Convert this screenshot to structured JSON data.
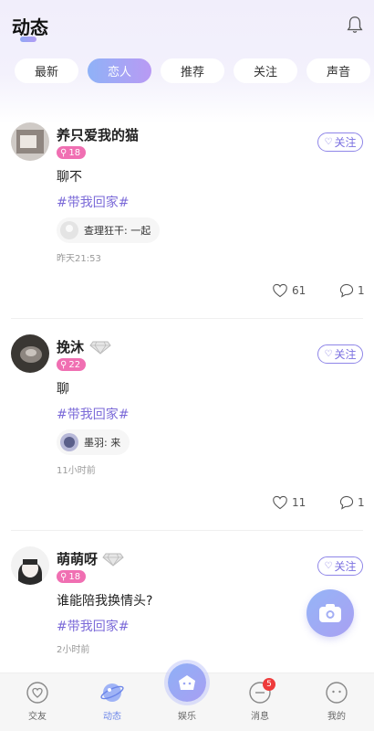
{
  "header": {
    "title": "动态"
  },
  "tabs": [
    {
      "label": "最新",
      "active": false
    },
    {
      "label": "恋人",
      "active": true
    },
    {
      "label": "推荐",
      "active": false
    },
    {
      "label": "关注",
      "active": false
    },
    {
      "label": "声音",
      "active": false
    }
  ],
  "posts": [
    {
      "username": "养只爱我的猫",
      "age": "18",
      "follow_label": "关注",
      "text": "聊不",
      "topic": "#带我回家#",
      "comment_preview": "查理狂干: 一起",
      "time": "昨天21:53",
      "likes": "61",
      "comments": "1"
    },
    {
      "username": "挽沐",
      "age": "22",
      "follow_label": "关注",
      "text": "聊",
      "topic": "#带我回家#",
      "comment_preview": "墨羽: 来",
      "time": "11小时前",
      "likes": "11",
      "comments": "1"
    },
    {
      "username": "萌萌呀",
      "age": "18",
      "follow_label": "关注",
      "text": "谁能陪我换情头?",
      "topic": "#带我回家#",
      "time": "2小时前"
    }
  ],
  "nav": {
    "friends": "交友",
    "moments": "动态",
    "entertainment": "娱乐",
    "messages": "消息",
    "messages_badge": "5",
    "me": "我的"
  },
  "colors": {
    "accent": "#7b6ad8",
    "age_badge": "#f06fb2",
    "nav_active": "#6c86e9"
  },
  "icons": [
    "bell-icon",
    "heart-icon",
    "comment-icon",
    "camera-icon",
    "diamond-icon"
  ]
}
